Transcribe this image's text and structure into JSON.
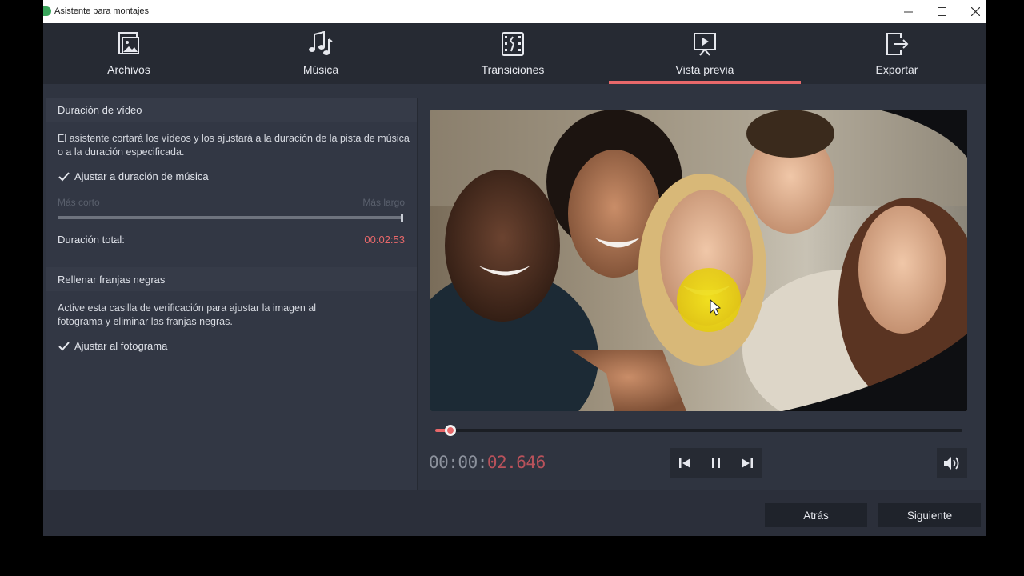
{
  "window": {
    "title": "Asistente para montajes",
    "controls": [
      "minimize",
      "maximize",
      "close"
    ]
  },
  "nav": {
    "items": [
      {
        "label": "Archivos",
        "icon": "image-file-icon"
      },
      {
        "label": "Música",
        "icon": "music-notes-icon"
      },
      {
        "label": "Transiciones",
        "icon": "film-transition-icon"
      },
      {
        "label": "Vista previa",
        "icon": "preview-play-icon",
        "active": true
      },
      {
        "label": "Exportar",
        "icon": "export-icon"
      }
    ]
  },
  "video_duration": {
    "heading": "Duración de vídeo",
    "description": "El asistente cortará los vídeos y los ajustará a la duración de la pista de música o a la duración especificada.",
    "fit_music_label": "Ajustar a duración de música",
    "fit_music_checked": true,
    "shorter_label": "Más corto",
    "longer_label": "Más largo",
    "total_label": "Duración total:",
    "total_value": "00:02:53"
  },
  "black_bars": {
    "heading": "Rellenar franjas negras",
    "description": "Active esta casilla de verificación para ajustar la imagen al fotograma y eliminar las franjas negras.",
    "fit_frame_label": "Ajustar al fotograma",
    "fit_frame_checked": true
  },
  "player": {
    "timecode_dim": "00:00:",
    "timecode_active": "02.646",
    "progress": 0.024,
    "controls": [
      "previous-icon",
      "pause-icon",
      "next-icon",
      "volume-icon"
    ]
  },
  "footer": {
    "back_label": "Atrás",
    "next_label": "Siguiente"
  },
  "colors": {
    "accent": "#e8686a",
    "panel": "#323744",
    "nav": "#262a33"
  }
}
